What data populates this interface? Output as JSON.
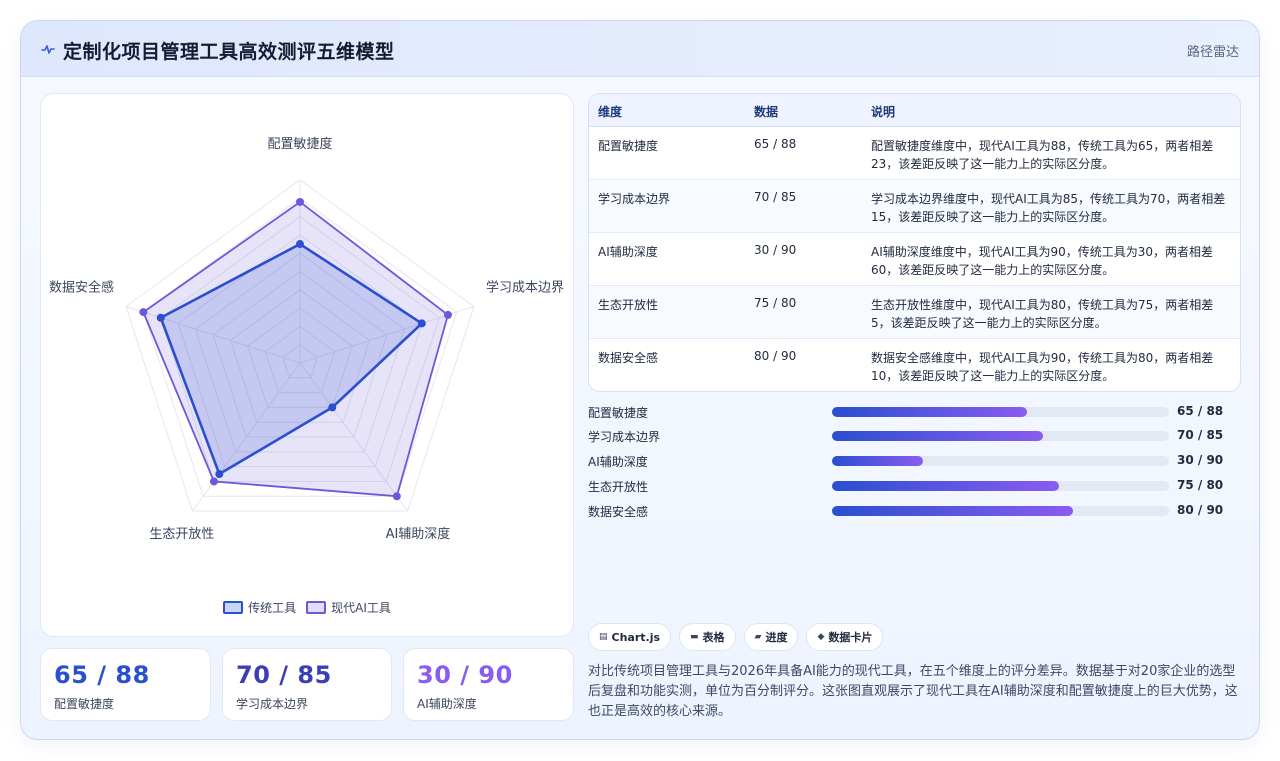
{
  "header": {
    "title": "定制化项目管理工具高效测评五维模型",
    "tag": "路径雷达",
    "icon": "pulse-icon"
  },
  "legend": [
    {
      "label": "传统工具",
      "color": "#2a4fcf"
    },
    {
      "label": "现代AI工具",
      "color": "#6a5ad8"
    }
  ],
  "stats": [
    {
      "value": "65 / 88",
      "label": "配置敏捷度",
      "color": "#2a4fcf"
    },
    {
      "value": "70 / 85",
      "label": "学习成本边界",
      "color": "#3b3fb6"
    },
    {
      "value": "30 / 90",
      "label": "AI辅助深度",
      "color": "#8a5cf0"
    }
  ],
  "table": {
    "headers": [
      "维度",
      "数据",
      "说明"
    ],
    "rows": [
      {
        "dim": "配置敏捷度",
        "data": "65 / 88",
        "desc": "配置敏捷度维度中，现代AI工具为88，传统工具为65，两者相差23，该差距反映了这一能力上的实际区分度。"
      },
      {
        "dim": "学习成本边界",
        "data": "70 / 85",
        "desc": "学习成本边界维度中，现代AI工具为85，传统工具为70，两者相差15，该差距反映了这一能力上的实际区分度。"
      },
      {
        "dim": "AI辅助深度",
        "data": "30 / 90",
        "desc": "AI辅助深度维度中，现代AI工具为90，传统工具为30，两者相差60，该差距反映了这一能力上的实际区分度。"
      },
      {
        "dim": "生态开放性",
        "data": "75 / 80",
        "desc": "生态开放性维度中，现代AI工具为80，传统工具为75，两者相差5，该差距反映了这一能力上的实际区分度。"
      },
      {
        "dim": "数据安全感",
        "data": "80 / 90",
        "desc": "数据安全感维度中，现代AI工具为90，传统工具为80，两者相差10，该差距反映了这一能力上的实际区分度。"
      }
    ]
  },
  "progress": [
    {
      "label": "配置敏捷度",
      "value": "65 / 88",
      "fraction": 0.58
    },
    {
      "label": "学习成本边界",
      "value": "70 / 85",
      "fraction": 0.625
    },
    {
      "label": "AI辅助深度",
      "value": "30 / 90",
      "fraction": 0.27
    },
    {
      "label": "生态开放性",
      "value": "75 / 80",
      "fraction": 0.675
    },
    {
      "label": "数据安全感",
      "value": "80 / 90",
      "fraction": 0.715
    }
  ],
  "tags": [
    {
      "label": "Chart.js",
      "icon": "chart-icon"
    },
    {
      "label": "表格",
      "icon": "table-icon"
    },
    {
      "label": "进度",
      "icon": "progress-icon"
    },
    {
      "label": "数据卡片",
      "icon": "card-icon"
    }
  ],
  "description": "对比传统项目管理工具与2026年具备AI能力的现代工具，在五个维度上的评分差异。数据基于对20家企业的选型后复盘和功能实测，单位为百分制评分。这张图直观展示了现代工具在AI辅助深度和配置敏捷度上的巨大优势，这也正是高效的核心来源。",
  "chart_data": {
    "type": "radar",
    "categories": [
      "配置敏捷度",
      "学习成本边界",
      "AI辅助深度",
      "生态开放性",
      "数据安全感"
    ],
    "series": [
      {
        "name": "传统工具",
        "values": [
          65,
          70,
          30,
          75,
          80
        ],
        "color": "#2a4fcf"
      },
      {
        "name": "现代AI工具",
        "values": [
          88,
          85,
          90,
          80,
          90
        ],
        "color": "#6a5ad8"
      }
    ],
    "rlim": [
      0,
      100
    ],
    "grid": true,
    "legend_position": "bottom"
  }
}
